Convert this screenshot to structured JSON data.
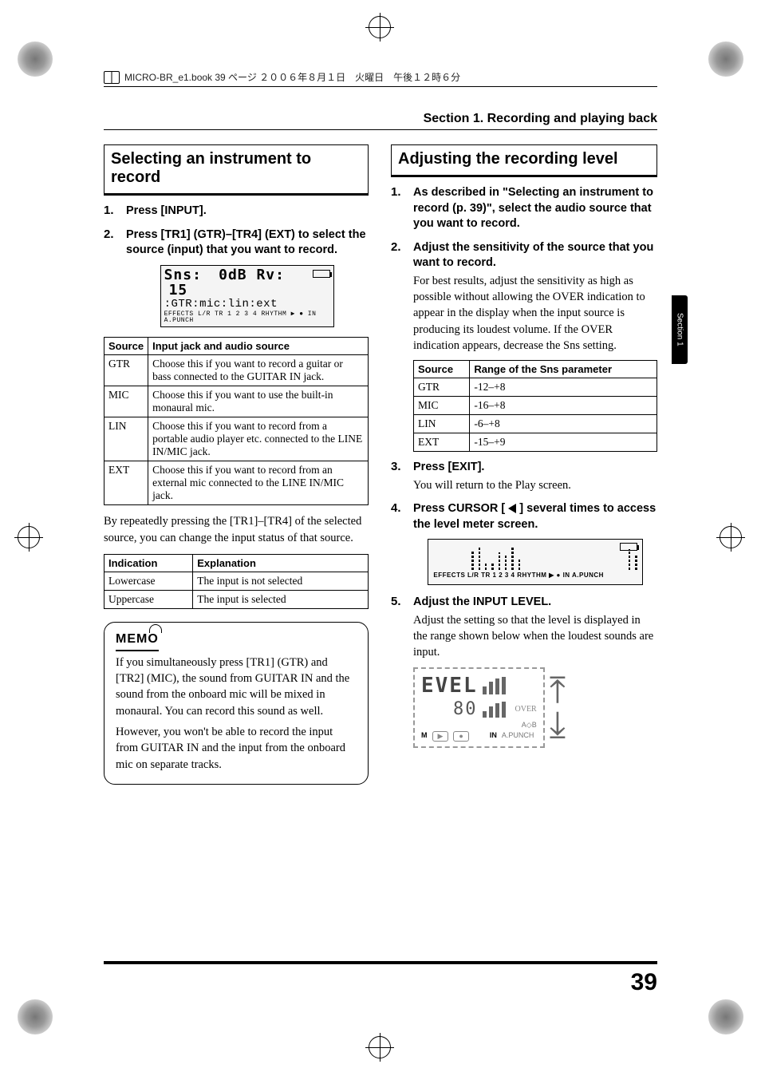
{
  "header_text": "MICRO-BR_e1.book 39 ページ ２００６年８月１日　火曜日　午後１２時６分",
  "running_head": "Section 1. Recording and playing back",
  "side_tab": "Section 1",
  "page_number": "39",
  "left": {
    "h2": "Selecting an instrument to record",
    "steps": [
      {
        "head": "Press [INPUT]."
      },
      {
        "head": "Press [TR1] (GTR)–[TR4] (EXT) to select the source (input) that you want to record."
      }
    ],
    "lcd": {
      "row1_left": "Sns:",
      "row1_mid": "0dB Rv:",
      "row1_right": "15",
      "row2": ":GTR:mic:lin:ext",
      "row3": "EFFECTS  L/R  TR 1  2  3  4   RHYTHM   ▶  ●   IN  A.PUNCH"
    },
    "table1": {
      "headers": [
        "Source",
        "Input jack and audio source"
      ],
      "rows": [
        [
          "GTR",
          "Choose this if you want to record a guitar or bass connected to the GUITAR IN jack."
        ],
        [
          "MIC",
          "Choose this if you want to use the built-in monaural mic."
        ],
        [
          "LIN",
          "Choose this if you want to record from a portable audio player etc. connected to the LINE IN/MIC jack."
        ],
        [
          "EXT",
          "Choose this if you want to record from an external mic connected to the LINE IN/MIC jack."
        ]
      ]
    },
    "para": "By repeatedly pressing the [TR1]–[TR4] of the selected source, you can change the input status of that source.",
    "table2": {
      "headers": [
        "Indication",
        "Explanation"
      ],
      "rows": [
        [
          "Lowercase",
          "The input is not selected"
        ],
        [
          "Uppercase",
          "The input is selected"
        ]
      ]
    },
    "memo_label": "MEMO",
    "memo_p1": "If you simultaneously press [TR1] (GTR) and [TR2] (MIC), the sound from GUITAR IN and the sound from the onboard mic will be mixed in monaural. You can record this sound as well.",
    "memo_p2": "However, you won't be able to record the input from GUITAR IN and the input from the onboard mic on separate tracks."
  },
  "right": {
    "h2": "Adjusting the recording level",
    "steps": [
      {
        "head": "As described in \"Selecting an instrument to record (p. 39)\", select the audio source that you want to record."
      },
      {
        "head": "Adjust the sensitivity of the source that you want to record.",
        "body": "For best results, adjust the sensitivity as high as possible without allowing the OVER indication to appear in the display when the input source is producing its loudest volume. If the OVER indication appears, decrease the Sns setting."
      },
      {
        "head": "Press [EXIT].",
        "body": "You will return to the Play screen."
      },
      {
        "head_pre": "Press CURSOR [ ",
        "head_post": " ] several times to access the level meter screen."
      },
      {
        "head": "Adjust the INPUT LEVEL.",
        "body": "Adjust the setting so that the level is displayed in the range shown below when the loudest sounds are input."
      }
    ],
    "sns_table": {
      "headers": [
        "Source",
        "Range of the Sns parameter"
      ],
      "rows": [
        [
          "GTR",
          "-12–+8"
        ],
        [
          "MIC",
          "-16–+8"
        ],
        [
          "LIN",
          "-6–+8"
        ],
        [
          "EXT",
          "-15–+9"
        ]
      ]
    },
    "lcd_legend": "EFFECTS  L/R  TR 1  2  3  4    RHYTHM  ▶   ●    IN   A.PUNCH",
    "level_fig": {
      "title": "EVEL",
      "value": "80",
      "tag1": "OVER",
      "tag2": "A◇B",
      "btn1": "▶",
      "btn2": "●",
      "in": "IN",
      "punch": "A.PUNCH",
      "m": "M"
    }
  }
}
